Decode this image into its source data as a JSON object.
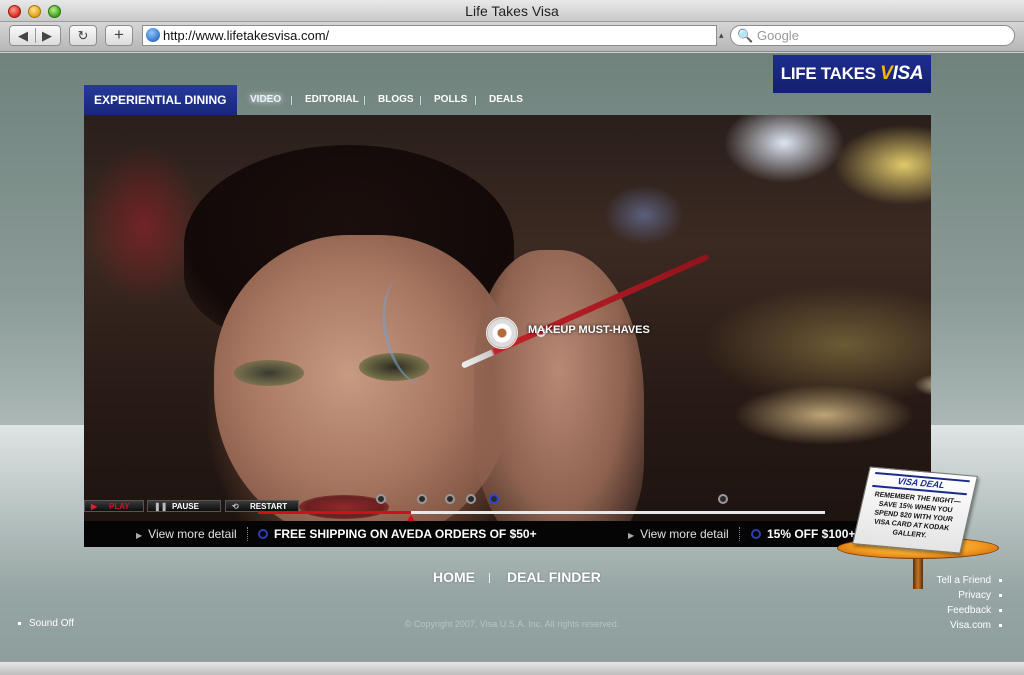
{
  "window": {
    "title": "Life Takes Visa"
  },
  "toolbar": {
    "back_glyph": "◀",
    "forward_glyph": "▶",
    "reload_glyph": "↻",
    "add_glyph": "+",
    "url": "http://www.lifetakesvisa.com/",
    "search_placeholder": "Google",
    "search_glyph": "🔍"
  },
  "brand": {
    "logo_text_prefix": "LIFE TAKES ",
    "logo_text_visa_v": "V",
    "logo_text_visa_rest": "ISA",
    "brand_blue": "#1d2d8f",
    "accent_gold": "#f7b600"
  },
  "nav": {
    "section_title": "EXPERIENTIAL DINING",
    "items": [
      {
        "label": "VIDEO",
        "active": true
      },
      {
        "label": "EDITORIAL",
        "active": false
      },
      {
        "label": "BLOGS",
        "active": false
      },
      {
        "label": "POLLS",
        "active": false
      },
      {
        "label": "DEALS",
        "active": false
      }
    ]
  },
  "video": {
    "hotspot_label": "MAKEUP MUST-HAVES",
    "controls": {
      "play_label": "PLAY",
      "pause_label": "PAUSE",
      "restart_label": "RESTART",
      "play_glyph": "▶",
      "pause_glyph": "❚❚",
      "restart_glyph": "⟲"
    },
    "timeline_progress": 0.27,
    "timeline_color": "#d10f1c"
  },
  "ticker": {
    "items": [
      {
        "link": "View more detail",
        "offer": "FREE SHIPPING ON AVEDA ORDERS OF $50+"
      },
      {
        "link": "View more detail",
        "offer": "15% OFF $100+"
      }
    ],
    "arrow_glyph": "▶"
  },
  "footer": {
    "nav": [
      "HOME",
      "DEAL FINDER"
    ],
    "sound_label": "Sound Off",
    "copyright": "© Copyright 2007, Visa U.S.A. Inc. All rights reserved.",
    "side_links": [
      "Tell a Friend",
      "Privacy",
      "Feedback",
      "Visa.com"
    ]
  },
  "visa_deal": {
    "title": "VISA DEAL",
    "text": "REMEMBER THE NIGHT—SAVE 15% WHEN YOU SPEND $20 WITH YOUR VISA CARD AT KODAK GALLERY."
  }
}
